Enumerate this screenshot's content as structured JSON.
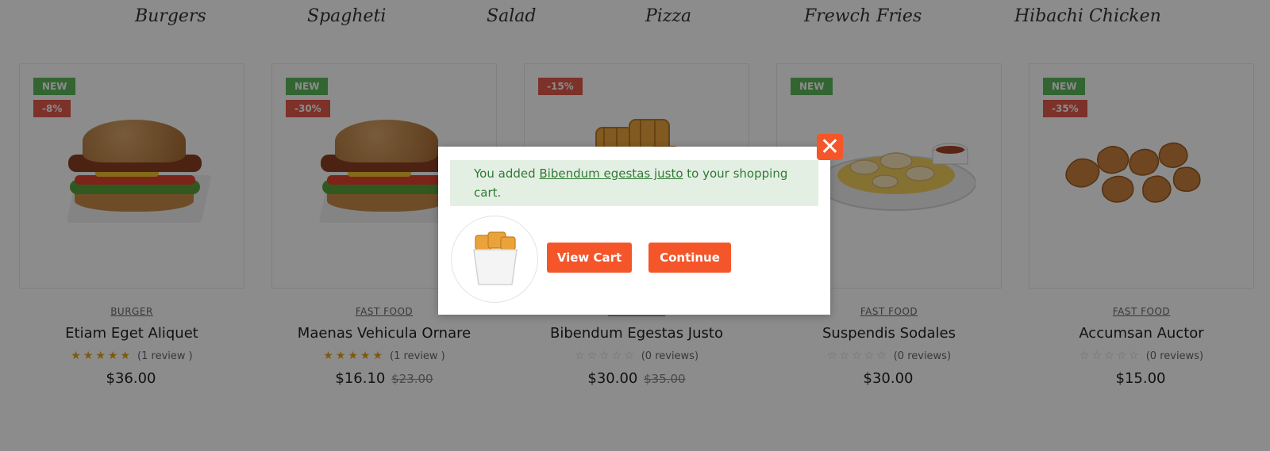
{
  "tabs": [
    "Burgers",
    "Spagheti",
    "Salad",
    "Pizza",
    "Frewch Fries",
    "Hibachi Chicken"
  ],
  "products": [
    {
      "badges": [
        "NEW",
        "-8%"
      ],
      "category": "BURGER",
      "title": "Etiam Eget Aliquet",
      "stars_filled": "★★★★★",
      "stars_empty": "",
      "reviews": "(1 review )",
      "price": "$36.00",
      "old_price": "",
      "image": "burger"
    },
    {
      "badges": [
        "NEW",
        "-30%"
      ],
      "category": "FAST FOOD",
      "title": "Maenas Vehicula Ornare",
      "stars_filled": "★★★★★",
      "stars_empty": "",
      "reviews": "(1 review )",
      "price": "$16.10",
      "old_price": "$23.00",
      "image": "burger"
    },
    {
      "badges": [
        "-15%"
      ],
      "category": "FAST FOOD",
      "title": "Bibendum Egestas Justo",
      "stars_filled": "",
      "stars_empty": "☆☆☆☆☆",
      "reviews": "(0 reviews)",
      "price": "$30.00",
      "old_price": "$35.00",
      "image": "waffle-fries"
    },
    {
      "badges": [
        "NEW"
      ],
      "category": "FAST FOOD",
      "title": "Suspendis Sodales",
      "stars_filled": "",
      "stars_empty": "☆☆☆☆☆",
      "reviews": "(0 reviews)",
      "price": "$30.00",
      "old_price": "",
      "image": "chicken-plate"
    },
    {
      "badges": [
        "NEW",
        "-35%"
      ],
      "category": "FAST FOOD",
      "title": "Accumsan Auctor",
      "stars_filled": "",
      "stars_empty": "☆☆☆☆☆",
      "reviews": "(0 reviews)",
      "price": "$15.00",
      "old_price": "",
      "image": "nuggets"
    }
  ],
  "modal": {
    "message_before": "You added ",
    "product_link": "Bibendum egestas justo",
    "message_after": " to your shopping cart.",
    "view_cart": "View Cart",
    "continue": "Continue",
    "close_icon": "close-icon"
  },
  "colors": {
    "accent": "#f4562a",
    "badge_new": "#5cb85c",
    "badge_sale": "#e25a4c",
    "notice_bg": "#e4efe4",
    "notice_text": "#2f7a32",
    "star": "#e2a31c"
  }
}
